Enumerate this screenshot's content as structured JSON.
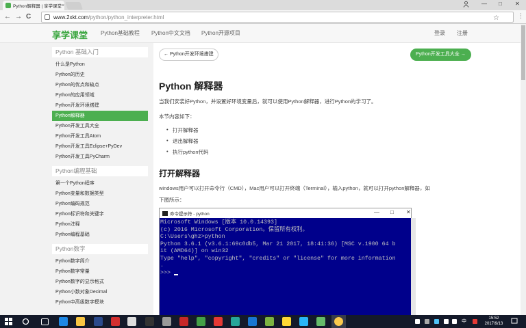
{
  "browser": {
    "tab_title": "Python解释器 | 享学课堂",
    "tab_close": "×",
    "url_host": "www.2xkt.com",
    "url_path": "/python/python_interpreter.html",
    "back": "←",
    "forward": "→",
    "reload": "C",
    "star": "☆",
    "menu": "⋮",
    "minimize": "—",
    "maximize": "□",
    "close": "✕"
  },
  "site": {
    "logo": "享学课堂",
    "nav": [
      "Python基础教程",
      "Python中文文档",
      "Python开源项目"
    ],
    "login": "登录",
    "register": "注册"
  },
  "sidebar": {
    "sections": [
      {
        "title": "Python 基础入门",
        "items": [
          "什么是Python",
          "Python的历史",
          "Python的优点和缺点",
          "Python的应用领域",
          "Python开发环境搭建",
          "Python解释器",
          "Python开发工具大全",
          "Python开发工具Atom",
          "Python开发工具Eclipse+PyDev",
          "Python开发工具PyCharm"
        ],
        "active": 5
      },
      {
        "title": "Python编程基础",
        "items": [
          "第一个Python程序",
          "Python变量和数据类型",
          "Python编码规范",
          "Python标识符和关键字",
          "Python注释",
          "Python编程基础"
        ]
      },
      {
        "title": "Python数字",
        "items": [
          "Python数字简介",
          "Python数字常量",
          "Python数字的显示格式",
          "Python小数对象Decimal",
          "Python中高级数字模块"
        ]
      }
    ]
  },
  "article": {
    "prev": "← Python开发环境搭建",
    "next": "Python开发工具大全 →",
    "title": "Python 解释器",
    "intro": "当我们安装好Python，并设置好环境变量后，就可以使用Python解释器，进行Python的学习了。",
    "toc_lead": "本节内容如下：",
    "toc": [
      "打开解释器",
      "退出解释器",
      "执行python代码"
    ],
    "section1_title": "打开解释器",
    "section1_p1": "windows用户可以打开命令行（CMD），Mac用户可以打开终端（Terminal），输入python，就可以打开python解释器，如",
    "section1_p2": "下图所示："
  },
  "cmd": {
    "title": "命令提示符 - python",
    "lines": [
      "Microsoft Windows [版本 10.0.14393]",
      "(c) 2016 Microsoft Corporation。保留所有权利。",
      "",
      "C:\\Users\\ghz>python",
      "Python 3.6.1 (v3.6.1:69c0db5, Mar 21 2017, 18:41:36) [MSC v.1900 64 b",
      "it (AMD64)] on win32",
      "Type \"help\", \"copyright\", \"credits\" or \"license\" for more information",
      "."
    ],
    "prompt": ">>> "
  },
  "taskbar": {
    "ime": "中",
    "time": "15:52",
    "date": "2017/9/13"
  }
}
